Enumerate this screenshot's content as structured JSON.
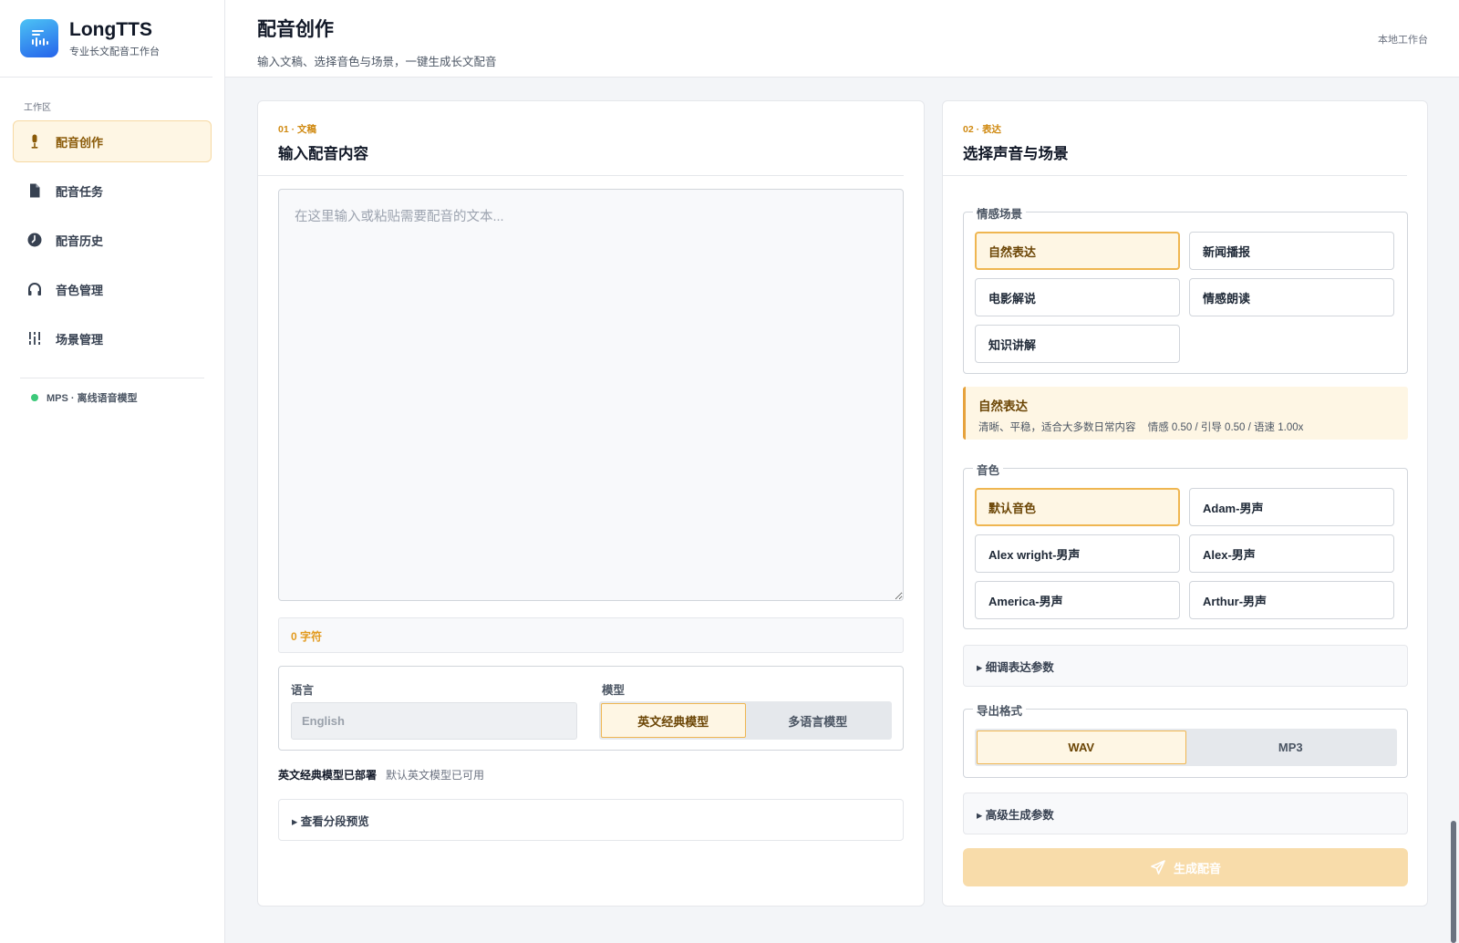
{
  "brand": {
    "name": "LongTTS",
    "subtitle": "专业长文配音工作台"
  },
  "sidebar": {
    "section_label": "工作区",
    "items": [
      {
        "label": "配音创作",
        "icon": "microphone-icon",
        "active": true
      },
      {
        "label": "配音任务",
        "icon": "document-icon",
        "active": false
      },
      {
        "label": "配音历史",
        "icon": "clock-icon",
        "active": false
      },
      {
        "label": "音色管理",
        "icon": "headphones-icon",
        "active": false
      },
      {
        "label": "场景管理",
        "icon": "sliders-icon",
        "active": false
      }
    ],
    "status": "MPS · 离线语音模型"
  },
  "header": {
    "title": "配音创作",
    "subtitle": "输入文稿、选择音色与场景，一键生成长文配音",
    "workspace_link": "本地工作台"
  },
  "left_card": {
    "kicker": "01 · 文稿",
    "title": "输入配音内容",
    "textarea_placeholder": "在这里输入或粘贴需要配音的文本...",
    "char_count": "0 字符",
    "language_label": "语言",
    "language_value": "English",
    "model_label": "模型",
    "models": [
      {
        "label": "英文经典模型",
        "active": true
      },
      {
        "label": "多语言模型",
        "active": false
      }
    ],
    "deploy_status": "英文经典模型已部署",
    "deploy_note": "默认英文模型已可用",
    "preview_toggle": "▸ 查看分段预览"
  },
  "right_card": {
    "kicker": "02 · 表达",
    "title": "选择声音与场景",
    "scene_legend": "情感场景",
    "scenes": [
      {
        "label": "自然表达",
        "active": true
      },
      {
        "label": "新闻播报",
        "active": false
      },
      {
        "label": "电影解说",
        "active": false
      },
      {
        "label": "情感朗读",
        "active": false
      },
      {
        "label": "知识讲解",
        "active": false
      }
    ],
    "scene_info": {
      "title": "自然表达",
      "description": "清晰、平稳，适合大多数日常内容",
      "params": "情感 0.50 / 引导 0.50 / 语速 1.00x"
    },
    "voice_legend": "音色",
    "voices": [
      {
        "label": "默认音色",
        "active": true
      },
      {
        "label": "Adam-男声",
        "active": false
      },
      {
        "label": "Alex wright-男声",
        "active": false
      },
      {
        "label": "Alex-男声",
        "active": false
      },
      {
        "label": "America-男声",
        "active": false
      },
      {
        "label": "Arthur-男声",
        "active": false
      }
    ],
    "fine_tune_toggle": "▸ 细调表达参数",
    "format_legend": "导出格式",
    "formats": [
      {
        "label": "WAV",
        "active": true
      },
      {
        "label": "MP3",
        "active": false
      }
    ],
    "advanced_toggle": "▸ 高级生成参数",
    "generate_label": "生成配音"
  },
  "colors": {
    "accent": "#efb651",
    "accent_bg": "#fef6e4",
    "status_green": "#3cc97a"
  }
}
